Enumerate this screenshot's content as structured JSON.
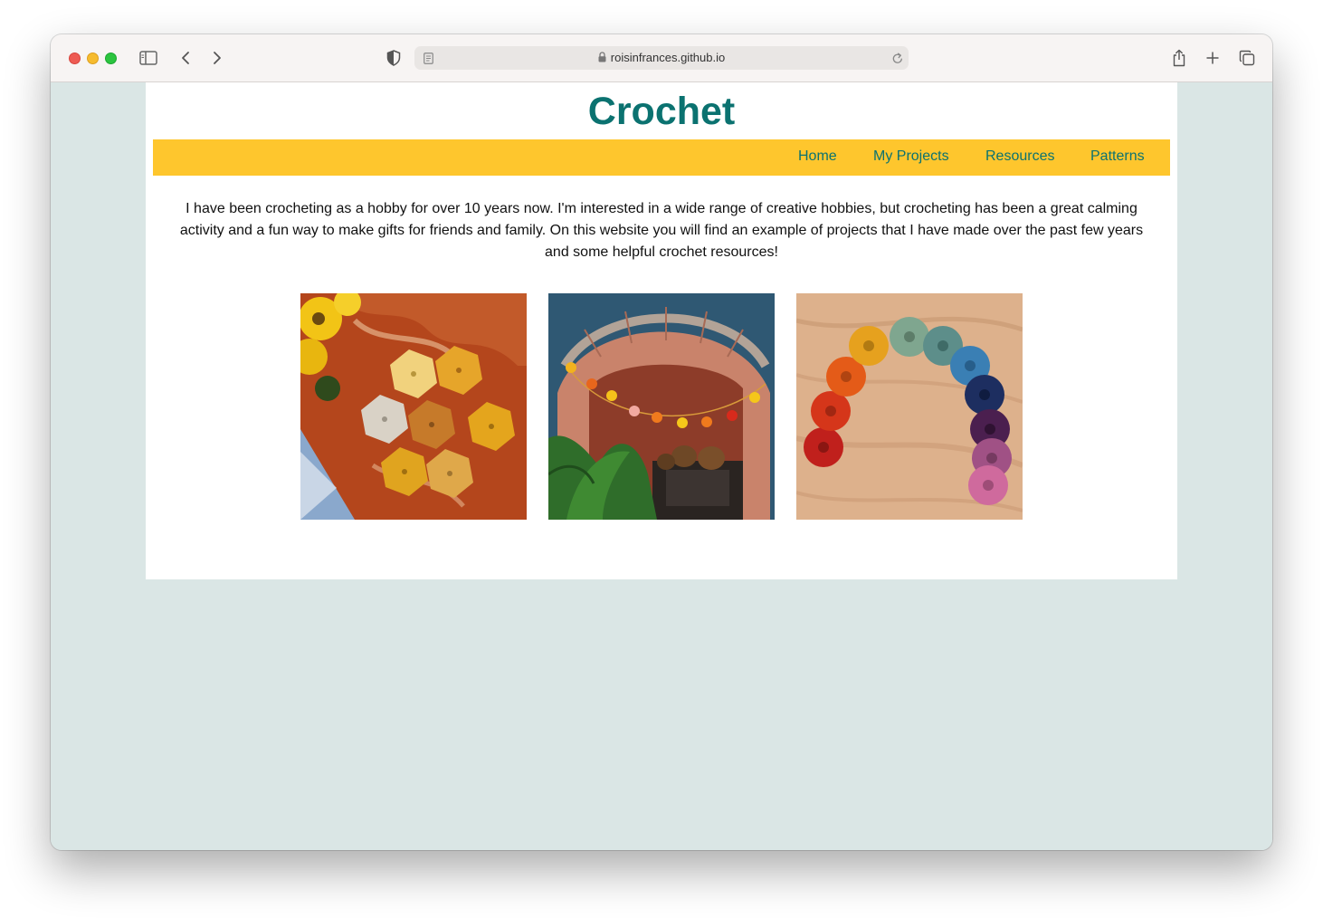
{
  "browser": {
    "url": "roisinfrances.github.io",
    "icons": [
      "sidebar-icon",
      "back-icon",
      "forward-icon",
      "shield-icon",
      "reader-icon",
      "lock-icon",
      "reload-icon",
      "share-icon",
      "new-tab-icon",
      "tabs-overview-icon"
    ]
  },
  "site": {
    "title": "Crochet",
    "nav": [
      {
        "label": "Home"
      },
      {
        "label": "My Projects"
      },
      {
        "label": "Resources"
      },
      {
        "label": "Patterns"
      }
    ],
    "intro": "I have been crocheting as a hobby for over 10 years now. I'm interested in a wide range of creative hobbies, but crocheting has been a great calming activity and a fun way to make gifts for friends and family. On this website you will find an example of projects that I have made over the past few years and some helpful crochet resources!"
  },
  "colors": {
    "accent": "#0b7270",
    "nav_background": "#fec62d",
    "page_background": "#dae6e5"
  }
}
